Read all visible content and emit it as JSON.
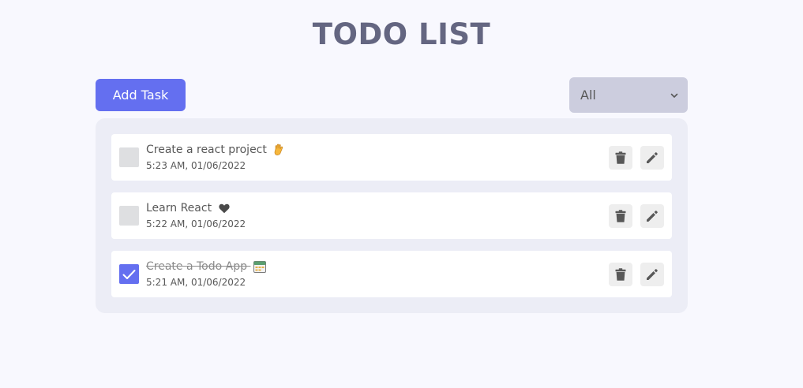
{
  "header": {
    "title": "TODO LIST"
  },
  "toolbar": {
    "add_label": "Add Task",
    "filter_value": "All"
  },
  "todos": [
    {
      "title": "Create a react project",
      "emoji": "waving-hand",
      "time": "5:23 AM, 01/06/2022",
      "completed": false
    },
    {
      "title": "Learn React",
      "emoji": "heart",
      "time": "5:22 AM, 01/06/2022",
      "completed": false
    },
    {
      "title": "Create a Todo App",
      "emoji": "calendar",
      "time": "5:21 AM, 01/06/2022",
      "completed": true
    }
  ],
  "colors": {
    "accent": "#646ff0",
    "title": "#646681",
    "background": "#f8f8fe",
    "panel": "#ecedf6",
    "filter_bg": "#cccdde"
  },
  "icons": {
    "delete": "trash-icon",
    "edit": "pencil-icon",
    "checked": "check-icon",
    "filter": "chevron-down-icon"
  }
}
